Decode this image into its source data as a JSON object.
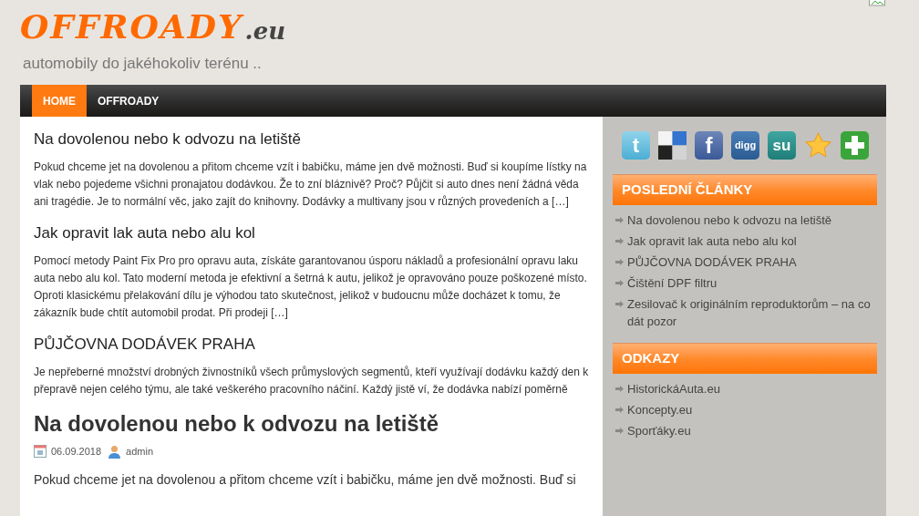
{
  "site": {
    "logo": "OFFROADY",
    "logo_suffix": ".eu",
    "tagline": "automobily do jakéhokoliv terénu .."
  },
  "nav": [
    {
      "label": "HOME",
      "selected": true
    },
    {
      "label": "OFFROADY",
      "selected": false
    }
  ],
  "excerpts": [
    {
      "title": "Na dovolenou nebo k odvozu na letiště",
      "text": "Pokud chceme jet na dovolenou a přitom chceme vzít i babičku, máme jen dvě možnosti. Buď si koupíme lístky na vlak nebo pojedeme všichni pronajatou dodávkou. Že to zní bláznivě? Proč? Půjčit si auto dnes není žádná věda ani tragédie. Je to normální věc, jako zajít do knihovny. Dodávky a multivany jsou v různých provedeních a",
      "more": "[…]"
    },
    {
      "title": "Jak opravit lak auta nebo alu kol",
      "text": "Pomocí metody Paint Fix Pro pro opravu auta, získáte garantovanou úsporu nákladů a profesionální opravu laku auta nebo alu kol. Tato moderní metoda je efektivní a šetrná k autu, jelikož je opravováno pouze poškozené místo. Oproti klasickému přelakování dílu je výhodou tato skutečnost, jelikož v budoucnu může docházet k tomu, že zákazník bude chtít automobil prodat. Při prodeji",
      "more": "[…]"
    },
    {
      "title": "PŮJČOVNA DODÁVEK PRAHA",
      "text": "Je nepřeberné množství drobných živnostníků všech průmyslových segmentů, kteří využívají dodávku každý den k přepravě nejen celého týmu, ale také veškerého pracovního náčiní. Každý jistě ví, že dodávka nabízí poměrně"
    }
  ],
  "post": {
    "title": "Na dovolenou nebo k odvozu na letiště",
    "date": "06.09.2018",
    "author": "admin",
    "body": "Pokud chceme jet na dovolenou a přitom chceme vzít i babičku, máme jen dvě možnosti. Buď si"
  },
  "social": [
    {
      "kind": "twitter",
      "glyph": "t"
    },
    {
      "kind": "delicious"
    },
    {
      "kind": "facebook",
      "glyph": "f"
    },
    {
      "kind": "digg",
      "glyph": "digg"
    },
    {
      "kind": "stumbleupon",
      "glyph": "su"
    },
    {
      "kind": "star"
    },
    {
      "kind": "plus"
    }
  ],
  "widgets": [
    {
      "title": "POSLEDNÍ ČLÁNKY",
      "items": [
        "Na dovolenou nebo k odvozu na letiště",
        "Jak opravit lak auta nebo alu kol",
        "PŮJČOVNA DODÁVEK PRAHA",
        "Čištění DPF filtru",
        "Zesilovač k originálním reproduktorům – na co dát pozor"
      ]
    },
    {
      "title": "ODKAZY",
      "items": [
        "HistorickáAuta.eu",
        "Koncepty.eu",
        "Sporťáky.eu"
      ]
    }
  ]
}
